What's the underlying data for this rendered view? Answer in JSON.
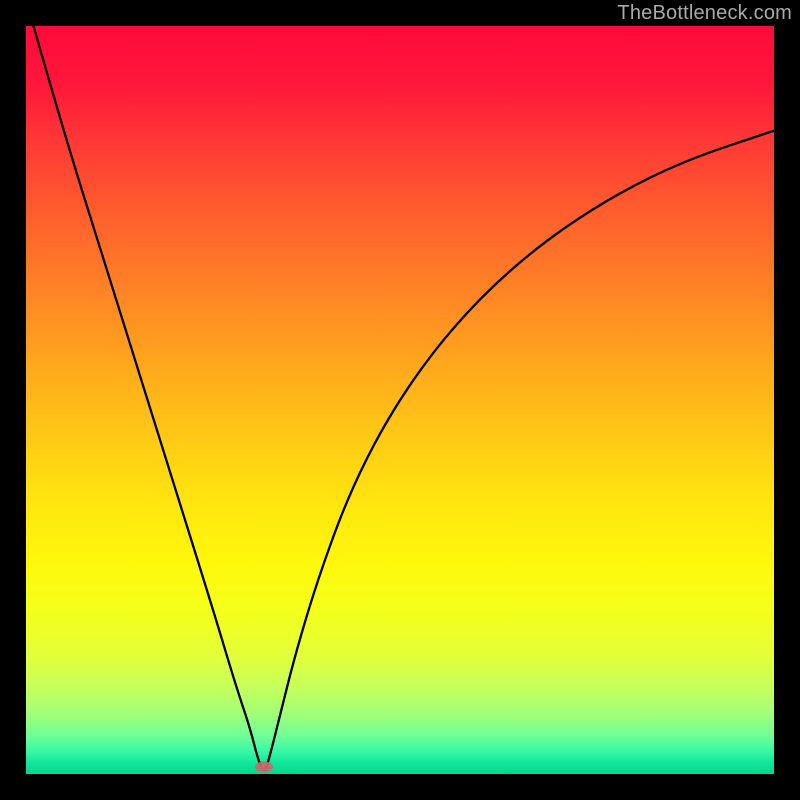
{
  "watermark": "TheBottleneck.com",
  "marker": {
    "x_pct": 31.8,
    "y_pct": 99.0
  },
  "colors": {
    "frame": "#000000",
    "top": "#ff0a3b",
    "bottom": "#08d58c",
    "curve": "#000000",
    "marker": "#c76b6e",
    "watermark": "#a9a9a9"
  },
  "chart_data": {
    "type": "line",
    "title": "",
    "xlabel": "",
    "ylabel": "",
    "xlim": [
      0,
      100
    ],
    "ylim": [
      0,
      100
    ],
    "grid": false,
    "legend": false,
    "annotations": [
      "TheBottleneck.com"
    ],
    "series": [
      {
        "name": "bottleneck-curve",
        "x": [
          1,
          5,
          10,
          15,
          20,
          25,
          28,
          30,
          31,
          31.8,
          32.5,
          34,
          36,
          39,
          43,
          48,
          54,
          61,
          69,
          78,
          88,
          100
        ],
        "y": [
          100,
          86,
          70,
          54,
          38,
          22,
          12,
          6,
          2,
          0,
          2,
          8,
          16,
          26,
          37,
          47,
          56,
          64,
          71,
          77,
          82,
          86
        ]
      }
    ],
    "marker_point": {
      "x": 31.8,
      "y": 0
    },
    "notes": "x and y are percentages of plot width/height from left and top. y=0 is the bottom (green), y=100 is the top (red). The curve is a V / check-shaped bottleneck curve with its minimum near x≈32%."
  }
}
